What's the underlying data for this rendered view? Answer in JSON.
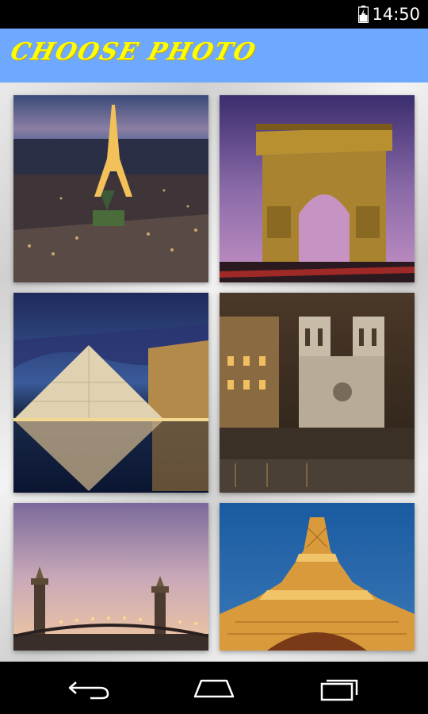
{
  "status_bar": {
    "time": "14:50",
    "icons": [
      "battery-charging-icon"
    ]
  },
  "header": {
    "title": "Choose Photo",
    "background_color": "#6fa8ff",
    "title_color": "#ffff00"
  },
  "photos": [
    {
      "subject": "eiffel-tower-aerial-night"
    },
    {
      "subject": "arc-de-triomphe-dusk"
    },
    {
      "subject": "louvre-pyramid-reflection"
    },
    {
      "subject": "notre-dame-seine-night"
    },
    {
      "subject": "pont-alexandre-iii-sunset"
    },
    {
      "subject": "eiffel-tower-from-below"
    }
  ],
  "nav_bar": {
    "icons": [
      "back-icon",
      "home-icon",
      "recent-apps-icon"
    ]
  }
}
